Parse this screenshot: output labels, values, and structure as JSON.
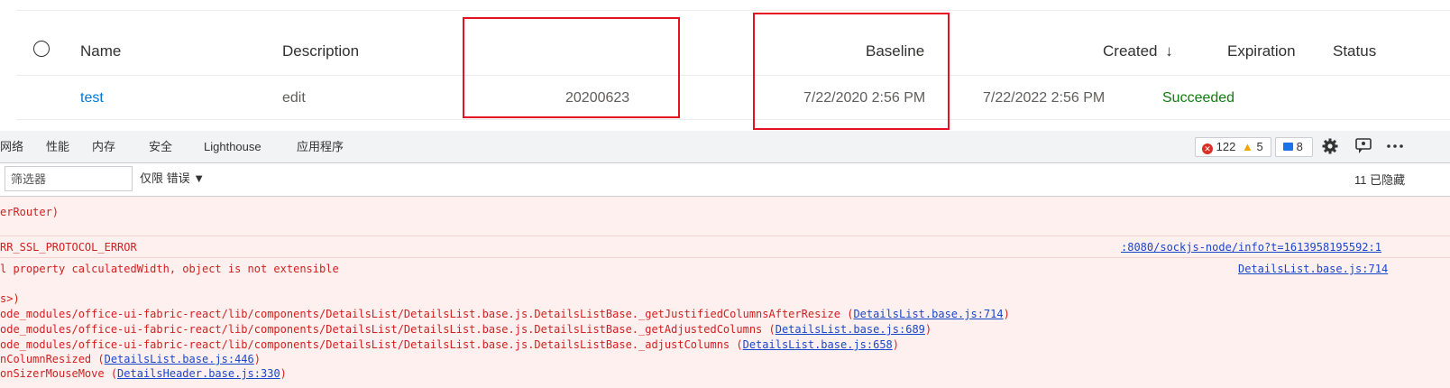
{
  "details_list": {
    "columns": {
      "name": "Name",
      "description": "Description",
      "baseline": "Baseline",
      "created": "Created",
      "sort_icon": "↓",
      "expiration": "Expiration",
      "status": "Status"
    },
    "row": {
      "name": "test",
      "description": "edit",
      "version": "20200623",
      "baseline": "7/22/2020 2:56 PM",
      "expiration": "7/22/2022 2:56 PM",
      "status": "Succeeded"
    }
  },
  "devtools": {
    "tabs": [
      "网络",
      "性能",
      "内存",
      "安全",
      "Lighthouse",
      "应用程序"
    ],
    "counts": {
      "errors": "122",
      "warnings": "5",
      "messages": "8"
    },
    "filter_placeholder": "筛选器",
    "level_select": "仅限 错误 ▼",
    "hidden_count": "11 已隐藏",
    "icons": {
      "error": "error-circle-icon",
      "warning": "warning-triangle-icon",
      "settings": "gear-icon",
      "customize": "dock-icon",
      "more": "more-icon"
    },
    "console": {
      "line1": "erRouter)",
      "line2_text": "RR_SSL_PROTOCOL_ERROR",
      "line2_link": ":8080/sockjs-node/info?t=1613958195592:1",
      "line3_text": "l property calculatedWidth, object is not extensible",
      "line3_link": "DetailsList.base.js:714",
      "line4": "s>)",
      "stack": [
        {
          "pre": "ode_modules/office-ui-fabric-react/lib/components/DetailsList/DetailsList.base.js.DetailsListBase._getJustifiedColumnsAfterResize (",
          "link": "DetailsList.base.js:714",
          "post": ")"
        },
        {
          "pre": "ode_modules/office-ui-fabric-react/lib/components/DetailsList/DetailsList.base.js.DetailsListBase._getAdjustedColumns (",
          "link": "DetailsList.base.js:689",
          "post": ")"
        },
        {
          "pre": "ode_modules/office-ui-fabric-react/lib/components/DetailsList/DetailsList.base.js.DetailsListBase._adjustColumns (",
          "link": "DetailsList.base.js:658",
          "post": ")"
        },
        {
          "pre": "nColumnResized (",
          "link": "DetailsList.base.js:446",
          "post": ")"
        },
        {
          "pre": "onSizerMouseMove (",
          "link": "DetailsHeader.base.js:330",
          "post": ")"
        }
      ]
    }
  },
  "colors": {
    "accent": "#0078d4",
    "success": "#107c10",
    "highlight": "#e81123",
    "console_error": "#d02020"
  }
}
